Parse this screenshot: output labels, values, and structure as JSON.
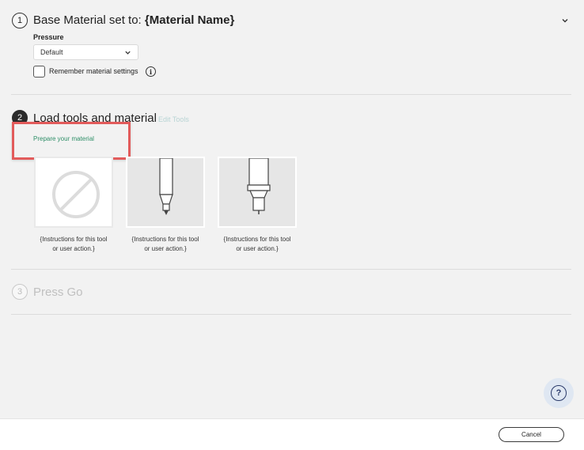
{
  "step1": {
    "number": "1",
    "title_prefix": "Base Material set to:",
    "title_value": "{Material Name}",
    "pressure_label": "Pressure",
    "pressure_value": "Default",
    "remember_label": "Remember material settings",
    "info_glyph": "i"
  },
  "step2": {
    "number": "2",
    "title": "Load tools and material",
    "edit_tools": "Edit Tools",
    "prepare": "Prepare your material",
    "tools": [
      {
        "icon": "no-tool-icon",
        "caption_line1": "{Instructions for this tool",
        "caption_line2": "or user action.}"
      },
      {
        "icon": "fine-point-pen-icon",
        "caption_line1": "{Instructions for this tool",
        "caption_line2": "or user action.}"
      },
      {
        "icon": "blade-housing-icon",
        "caption_line1": "{Instructions for this tool",
        "caption_line2": "or user action.}"
      }
    ]
  },
  "step3": {
    "number": "3",
    "title": "Press Go"
  },
  "help": {
    "glyph": "?"
  },
  "footer": {
    "cancel_label": "Cancel"
  },
  "colors": {
    "highlight": "#e25b5b",
    "link_muted": "#b8d4d4",
    "prepare_text": "#2f8f68",
    "help_bg": "#dfe7f2",
    "help_fg": "#2a3a6a"
  }
}
